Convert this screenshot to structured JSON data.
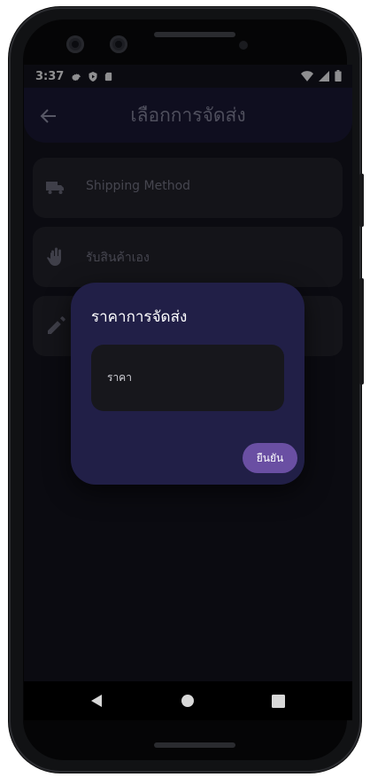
{
  "status_bar": {
    "time": "3:37",
    "left_icons": [
      "gear-icon",
      "shield-play-icon",
      "sd-card-icon"
    ],
    "right_icons": [
      "wifi-icon",
      "signal-icon",
      "battery-icon"
    ]
  },
  "app_bar": {
    "title": "เลือกการจัดส่ง",
    "back_icon": "arrow-left-icon"
  },
  "options": [
    {
      "icon": "truck-icon",
      "label": "Shipping Method"
    },
    {
      "icon": "hand-icon",
      "label": "รับสินค้าเอง"
    },
    {
      "icon": "pencil-icon",
      "label": ""
    }
  ],
  "dialog": {
    "title": "ราคาการจัดส่ง",
    "input_placeholder": "ราคา",
    "input_value": "",
    "confirm_label": "ยืนยัน"
  },
  "nav_bar": {
    "buttons": [
      "back-triangle-icon",
      "home-circle-icon",
      "recents-square-icon"
    ]
  },
  "colors": {
    "screen_bg": "#0f0f16",
    "appbar_bg": "#161530",
    "card_bg": "#1f1f26",
    "dialog_bg": "#211f47",
    "field_bg": "#17171c",
    "accent": "#6a4fa3"
  }
}
